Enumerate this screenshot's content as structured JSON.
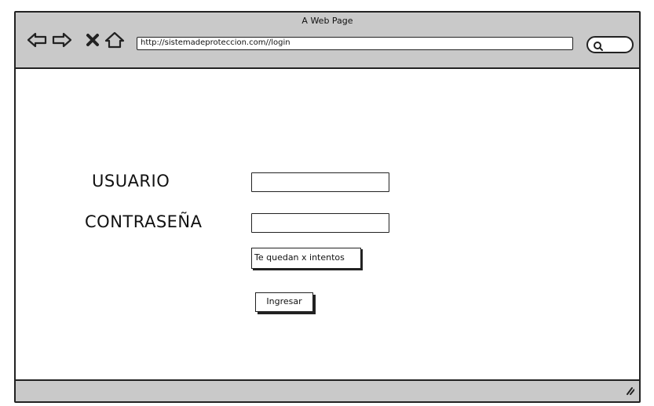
{
  "window": {
    "title": "A Web Page"
  },
  "toolbar": {
    "back_icon": "back-arrow-icon",
    "forward_icon": "forward-arrow-icon",
    "stop_icon": "close-icon",
    "home_icon": "home-icon",
    "url": "http://sistemadeproteccion.com//login",
    "search_icon": "search-icon"
  },
  "login": {
    "user_label": "USUARIO",
    "user_value": "",
    "password_label": "CONTRASEÑA",
    "password_value": "",
    "attempts_notice": "Te quedan x intentos",
    "submit_label": "Ingresar"
  },
  "colors": {
    "chrome": "#c9c9c9",
    "ink": "#222222",
    "background": "#ffffff"
  }
}
